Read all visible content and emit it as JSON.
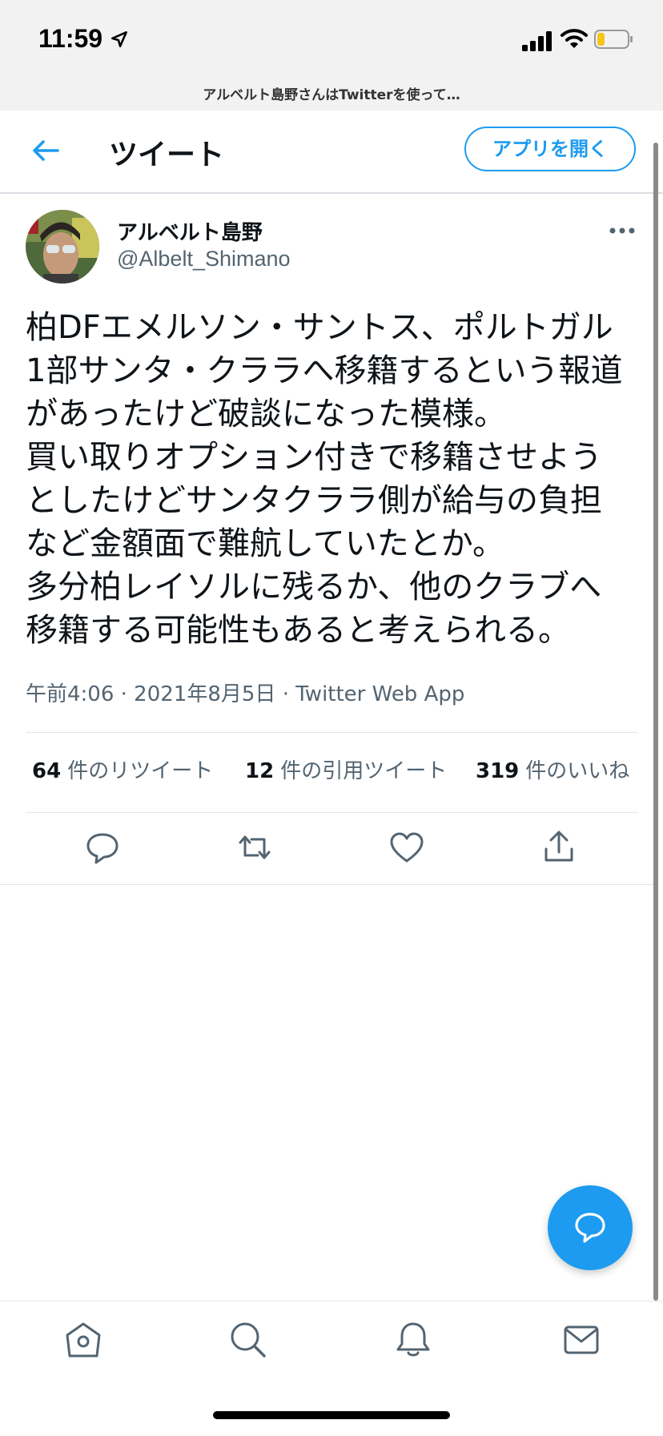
{
  "status_bar": {
    "time": "11:59",
    "page_title": "アルベルト島野さんはTwitterを使って…"
  },
  "header": {
    "title": "ツイート",
    "open_app_label": "アプリを開く"
  },
  "tweet": {
    "author_name": "アルベルト島野",
    "author_handle": "@Albelt_Shimano",
    "text": "柏DFエメルソン・サントス、ポルトガル\n1部サンタ・クララへ移籍するという報道\nがあったけど破談になった模様。\n買い取りオプション付きで移籍させよう\nとしたけどサンタクララ側が給与の負担\nなど金額面で難航していたとか。\n多分柏レイソルに残るか、他のクラブへ\n移籍する可能性もあると考えられる。",
    "meta": "午前4:06 · 2021年8月5日 · Twitter Web App"
  },
  "stats": {
    "retweets": {
      "count": "64",
      "label": "件のリツイート"
    },
    "quotes": {
      "count": "12",
      "label": "件の引用ツイート"
    },
    "likes": {
      "count": "319",
      "label": "件のいいね"
    }
  },
  "icons": {
    "actions": [
      "reply-icon",
      "retweet-icon",
      "like-icon",
      "share-icon"
    ],
    "tabs": [
      "home-icon",
      "search-icon",
      "notifications-icon",
      "messages-icon"
    ]
  },
  "colors": {
    "accent": "#1d9bf0",
    "text": "#0f1419",
    "secondary": "#536471"
  }
}
